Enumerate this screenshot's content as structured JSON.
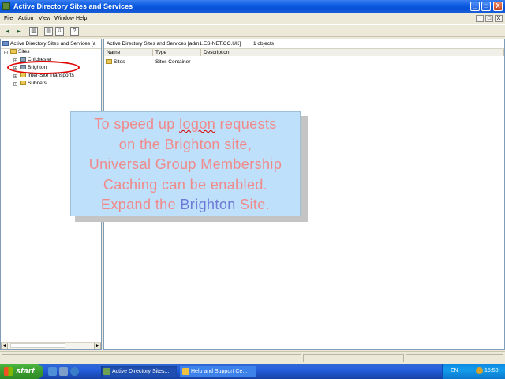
{
  "window": {
    "title": "Active Directory Sites and Services",
    "buttons": {
      "minimize": "_",
      "maximize": "□",
      "close": "X"
    }
  },
  "menu": {
    "items": [
      "File",
      "Action",
      "View",
      "Window",
      "Help"
    ],
    "mdi_buttons": [
      "_",
      "□",
      "X"
    ]
  },
  "toolbar": {
    "icons": [
      "back-icon",
      "forward-icon",
      "show-hide-tree-icon",
      "properties-icon",
      "export-list-icon",
      "help-icon"
    ]
  },
  "left_pane": {
    "header": "Active Directory Sites and Services [a",
    "tree": {
      "root": "Sites",
      "children": [
        {
          "label": "Chichester"
        },
        {
          "label": "Brighton"
        },
        {
          "label": "Inter-Site Transports"
        },
        {
          "label": "Subnets"
        }
      ]
    }
  },
  "right_pane": {
    "header_path": "Active Directory Sites and Services [adm1.ES-NET.CO.UK]",
    "header_count": "1 objects",
    "columns": [
      "Name",
      "Type",
      "Description"
    ],
    "rows": [
      {
        "name": "Sites",
        "type": "Sites Container",
        "description": ""
      }
    ]
  },
  "overlay": {
    "line1_a": "To speed up ",
    "line1_b": "logon",
    "line1_c": " requests",
    "line2": "on the Brighton site,",
    "line3": "Universal Group Membership",
    "line4": "Caching can be enabled.",
    "line5_a": "Expand the ",
    "line5_b": "Brighton",
    "line5_c": " Site."
  },
  "taskbar": {
    "start_label": "start",
    "tasks": [
      {
        "label": "Active Directory Sites...",
        "active": true
      },
      {
        "label": "Help and Support Ce...",
        "active": false
      }
    ],
    "tray": {
      "language": "EN",
      "clock": "15:50"
    }
  },
  "colors": {
    "overlay_bg": "#bfe0fb",
    "overlay_text": "#f08a8a",
    "overlay_highlight": "#6f7ad8",
    "annotation_ellipse": "#e00000",
    "titlebar": "#0a5ae0"
  }
}
